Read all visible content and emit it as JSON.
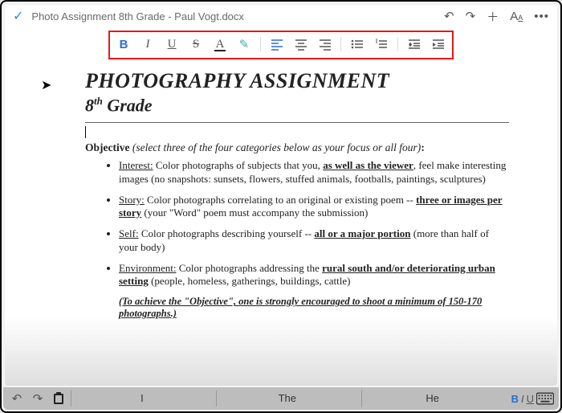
{
  "topbar": {
    "title": "Photo Assignment 8th Grade - Paul Vogt.docx"
  },
  "toolbar": {
    "bold": "B",
    "italic": "I",
    "underline": "U",
    "strike": "S",
    "textcolor": "A",
    "highlight": "✎"
  },
  "doc": {
    "h1": "PHOTOGRAPHY ASSIGNMENT",
    "h2_prefix": "8",
    "h2_sup": "th",
    "h2_suffix": " Grade",
    "objective_label": "Objective",
    "objective_note": " (select three of the four categories below as your focus or all four)",
    "objective_colon": ":",
    "bullets": [
      {
        "label": "Interest:",
        "pre": "  Color photographs of subjects that you, ",
        "bold": "as well as the viewer",
        "post": ", feel make interesting images (no snapshots:  sunsets, flowers, stuffed animals, footballs, paintings, sculptures)"
      },
      {
        "label": "Story:",
        "pre": "  Color photographs correlating to an original or existing poem -- ",
        "bold": "three or images per story",
        "post": "  (your \"Word\" poem must accompany the submission)"
      },
      {
        "label": "Self:",
        "pre": "  Color photographs describing yourself -- ",
        "bold": "all or a major portion",
        "post": " (more than half of your body)"
      },
      {
        "label": "Environment:",
        "pre": "  Color photographs addressing the ",
        "bold": "rural south and/or deteriorating urban setting",
        "post": " (people, homeless, gatherings, buildings, cattle)"
      }
    ],
    "note": "(To achieve the \"Objective\", one is strongly encouraged to shoot a minimum of 150-170 photographs.)"
  },
  "bottombar": {
    "suggest1": "I",
    "suggest2": "The",
    "suggest3": "He",
    "b": "B",
    "i": "I",
    "u": "U"
  }
}
